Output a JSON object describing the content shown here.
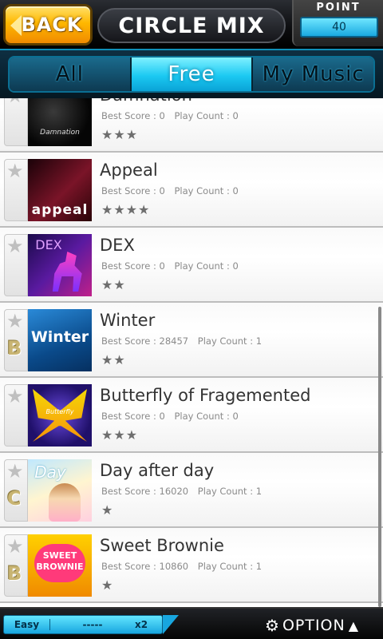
{
  "header": {
    "back_label": "BACK",
    "title": "CIRCLE MIX",
    "point_label": "POINT",
    "point_value": "40"
  },
  "tabs": [
    {
      "label": "All",
      "active": false
    },
    {
      "label": "Free",
      "active": true
    },
    {
      "label": "My Music",
      "active": false
    }
  ],
  "songs": [
    {
      "title": "Damnation",
      "best_score": "Best Score : 0",
      "play_count": "Play Count : 0",
      "stars": "★★★",
      "rank": "",
      "art_text": "Damnation",
      "art_color": "#101010"
    },
    {
      "title": "Appeal",
      "best_score": "Best Score : 0",
      "play_count": "Play Count : 0",
      "stars": "★★★★",
      "rank": "",
      "art_text": "appeal",
      "art_color": "#3a0a14"
    },
    {
      "title": "DEX",
      "best_score": "Best Score : 0",
      "play_count": "Play Count : 0",
      "stars": "★★",
      "rank": "",
      "art_text": "DEX",
      "art_color": "#3a0a6a"
    },
    {
      "title": "Winter",
      "best_score": "Best Score : 28457",
      "play_count": "Play Count : 1",
      "stars": "★★",
      "rank": "B",
      "art_text": "Winter",
      "art_color": "#0a5a9a"
    },
    {
      "title": "Butterfly of Fragemented",
      "best_score": "Best Score : 0",
      "play_count": "Play Count : 0",
      "stars": "★★★",
      "rank": "",
      "art_text": "Butterfly",
      "art_color": "#2a1a7a"
    },
    {
      "title": "Day after day",
      "best_score": "Best Score : 16020",
      "play_count": "Play Count : 1",
      "stars": "★",
      "rank": "C",
      "art_text": "Day",
      "art_color": "#8ad0f0"
    },
    {
      "title": "Sweet Brownie",
      "best_score": "Best Score : 10860",
      "play_count": "Play Count : 1",
      "stars": "★",
      "rank": "B",
      "art_text": "SWEET BROWNIE",
      "art_color": "#f0a000"
    }
  ],
  "bottom": {
    "difficulty": "Easy",
    "mid": "-----",
    "speed": "x2",
    "option_label": "OPTION"
  },
  "icons": {
    "favorite": "star-outline-icon",
    "option": "gear-icon",
    "option_arrow": "triangle-up-icon"
  }
}
